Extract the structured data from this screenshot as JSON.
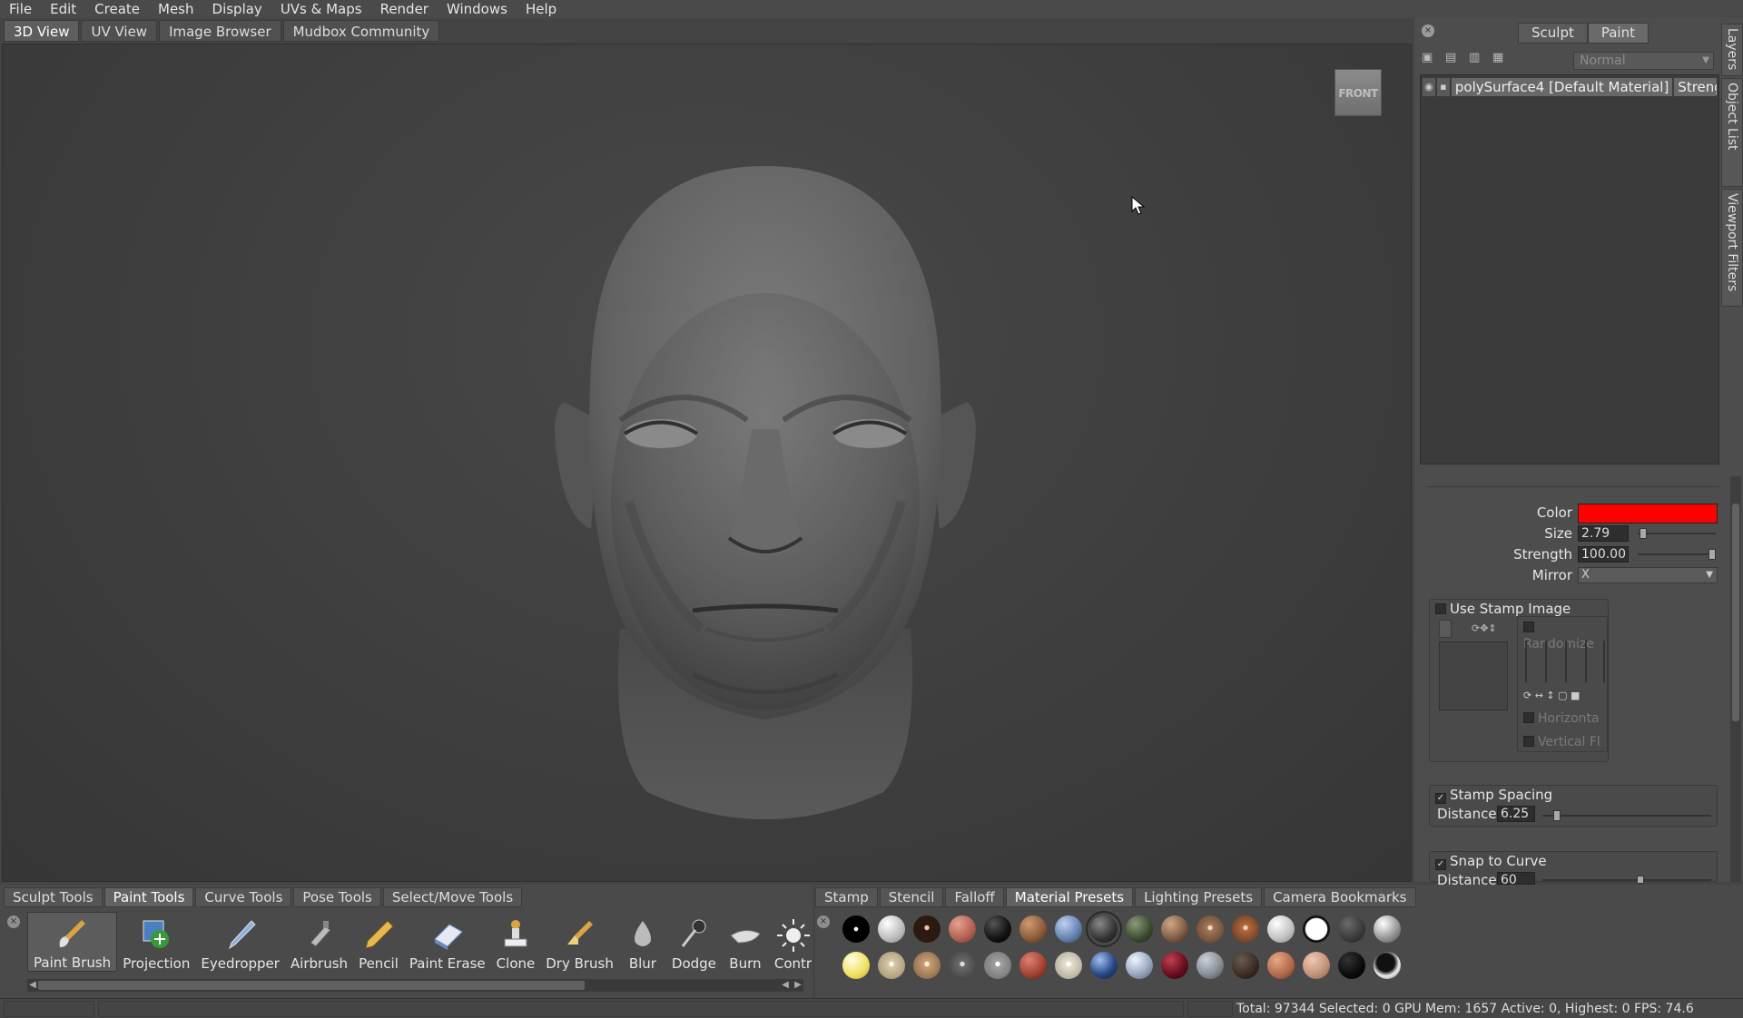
{
  "menu": [
    "File",
    "Edit",
    "Create",
    "Mesh",
    "Display",
    "UVs & Maps",
    "Render",
    "Windows",
    "Help"
  ],
  "view_tabs": [
    "3D View",
    "UV View",
    "Image Browser",
    "Mudbox Community"
  ],
  "viewcube_label": "FRONT",
  "mode_tabs": [
    "Sculpt",
    "Paint"
  ],
  "layers": {
    "blend_mode": "Normal",
    "row": {
      "name": "polySurface4 [Default Material]",
      "strength": "Strength"
    }
  },
  "side_tabs": [
    "Layers",
    "Object List",
    "Viewport Filters"
  ],
  "properties": {
    "color_label": "Color",
    "color_value": "#ff0000",
    "size_label": "Size",
    "size_value": "2.79",
    "size_fraction": 0.03,
    "strength_label": "Strength",
    "strength_value": "100.00",
    "strength_fraction": 1.0,
    "mirror_label": "Mirror",
    "mirror_value": "X",
    "use_stamp_label": "Use Stamp Image",
    "randomize_label": "Randomize",
    "horizontal_label": "Horizonta",
    "vertical_label": "Vertical Fl",
    "stamp_spacing_label": "Stamp Spacing",
    "stamp_distance_label": "Distance",
    "stamp_distance_value": "6.25",
    "snap_label": "Snap to Curve",
    "snap_distance_label": "Distance",
    "snap_distance_value": "60"
  },
  "tool_tabs": [
    "Sculpt Tools",
    "Paint Tools",
    "Curve Tools",
    "Pose Tools",
    "Select/Move Tools"
  ],
  "tools": [
    "Paint Brush",
    "Projection",
    "Eyedropper",
    "Airbrush",
    "Pencil",
    "Paint Erase",
    "Clone",
    "Dry Brush",
    "Blur",
    "Dodge",
    "Burn",
    "Contr"
  ],
  "preset_tabs": [
    "Stamp",
    "Stencil",
    "Falloff",
    "Material Presets",
    "Lighting Presets",
    "Camera Bookmarks"
  ],
  "status": "Total: 97344  Selected: 0 GPU Mem: 1657  Active: 0, Highest: 0  FPS: 74.6"
}
